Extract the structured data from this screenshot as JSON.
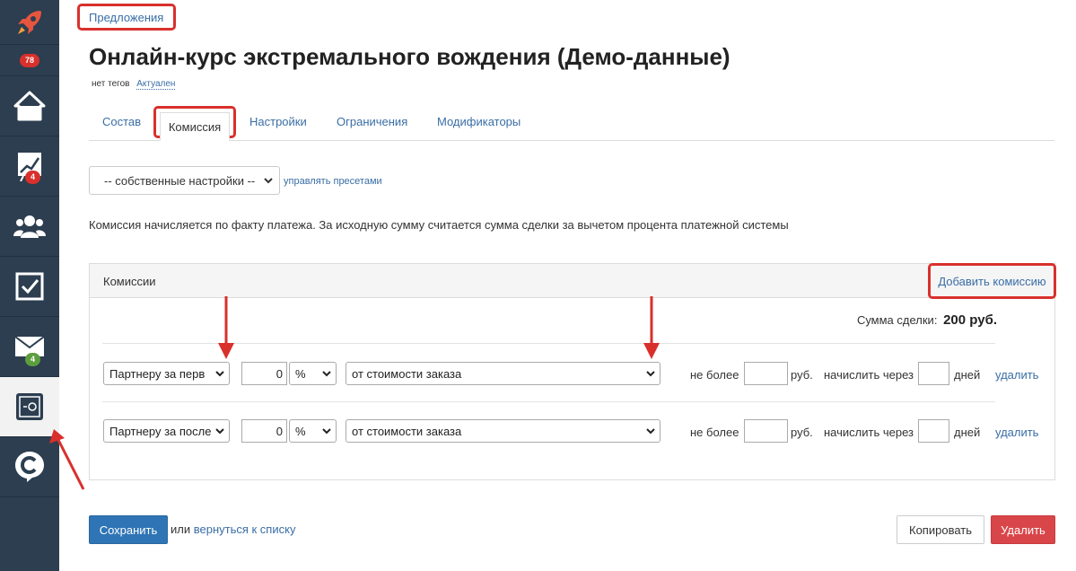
{
  "sidebar": {
    "items": [
      {
        "icon": "rocket-icon",
        "badge": "78",
        "badge_color": "#d9302c"
      },
      {
        "icon": "home-icon"
      },
      {
        "icon": "chart-icon",
        "badge": "4",
        "badge_color": "#d9302c"
      },
      {
        "icon": "users-icon"
      },
      {
        "icon": "checkbox-icon"
      },
      {
        "icon": "mail-icon",
        "badge": "4",
        "badge_color": "#5c9e3e"
      },
      {
        "icon": "safe-icon",
        "active": true
      },
      {
        "icon": "chat-c-icon"
      }
    ]
  },
  "breadcrumb": "Предложения",
  "page_title": "Онлайн-курс экстремального вождения (Демо-данные)",
  "tags_text": "нет тегов",
  "status_text": "Актуален",
  "tabs": [
    {
      "label": "Состав"
    },
    {
      "label": "Комиссия",
      "active": true
    },
    {
      "label": "Настройки"
    },
    {
      "label": "Ограничения"
    },
    {
      "label": "Модификаторы"
    }
  ],
  "preset": {
    "selected": "-- собственные настройки --",
    "manage_link": "управлять пресетами"
  },
  "note": "Комиссия начисляется по факту платежа. За исходную сумму считается сумма сделки за вычетом процента платежной системы",
  "panel": {
    "title": "Комиссии",
    "add_button": "Добавить комиссию",
    "sum_label": "Сумма сделки:",
    "sum_value": "200 руб.",
    "rows": [
      {
        "partner": "Партнеру за перв",
        "amount": "0",
        "unit": "%",
        "base": "от стоимости заказа",
        "max_label": "не более",
        "max_value": "",
        "currency": "руб.",
        "delay_label": "начислить через",
        "delay_value": "",
        "days": "дней",
        "delete": "удалить"
      },
      {
        "partner": "Партнеру за после",
        "amount": "0",
        "unit": "%",
        "base": "от стоимости заказа",
        "max_label": "не более",
        "max_value": "",
        "currency": "руб.",
        "delay_label": "начислить через",
        "delay_value": "",
        "days": "дней",
        "delete": "удалить"
      }
    ]
  },
  "footer": {
    "save": "Сохранить",
    "or": "или",
    "back": "вернуться к списку",
    "copy": "Копировать",
    "delete": "Удалить"
  },
  "colors": {
    "sidebar": "#2c3e50",
    "accent": "#3a6ea5",
    "highlight": "#d9302c",
    "primary_button": "#2f75b5",
    "danger_button": "#d9464a"
  }
}
